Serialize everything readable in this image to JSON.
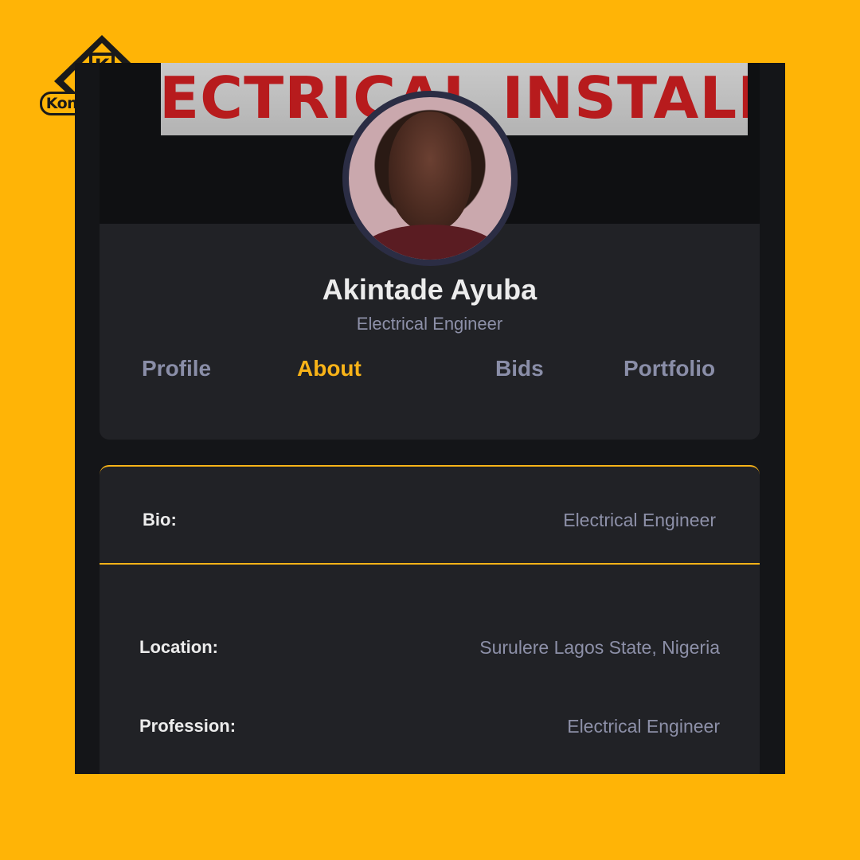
{
  "brand": {
    "logo_text": "KonstructApp",
    "logo_letter": "K"
  },
  "cover": {
    "banner_text": "ECTRICAL INSTALLATIO"
  },
  "profile": {
    "name": "Akintade Ayuba",
    "title": "Electrical Engineer"
  },
  "tabs": [
    {
      "label": "Profile",
      "active": false
    },
    {
      "label": "About",
      "active": true
    },
    {
      "label": "Bids",
      "active": false
    },
    {
      "label": "Portfolio",
      "active": false
    }
  ],
  "about": {
    "bio": {
      "label": "Bio:",
      "value": "Electrical Engineer"
    },
    "location": {
      "label": "Location:",
      "value": "Surulere Lagos State, Nigeria"
    },
    "profession": {
      "label": "Profession:",
      "value": "Electrical Engineer"
    }
  },
  "colors": {
    "background": "#FFB406",
    "accent": "#F8B318",
    "card": "#212226",
    "banner_text": "#b71b1d"
  }
}
